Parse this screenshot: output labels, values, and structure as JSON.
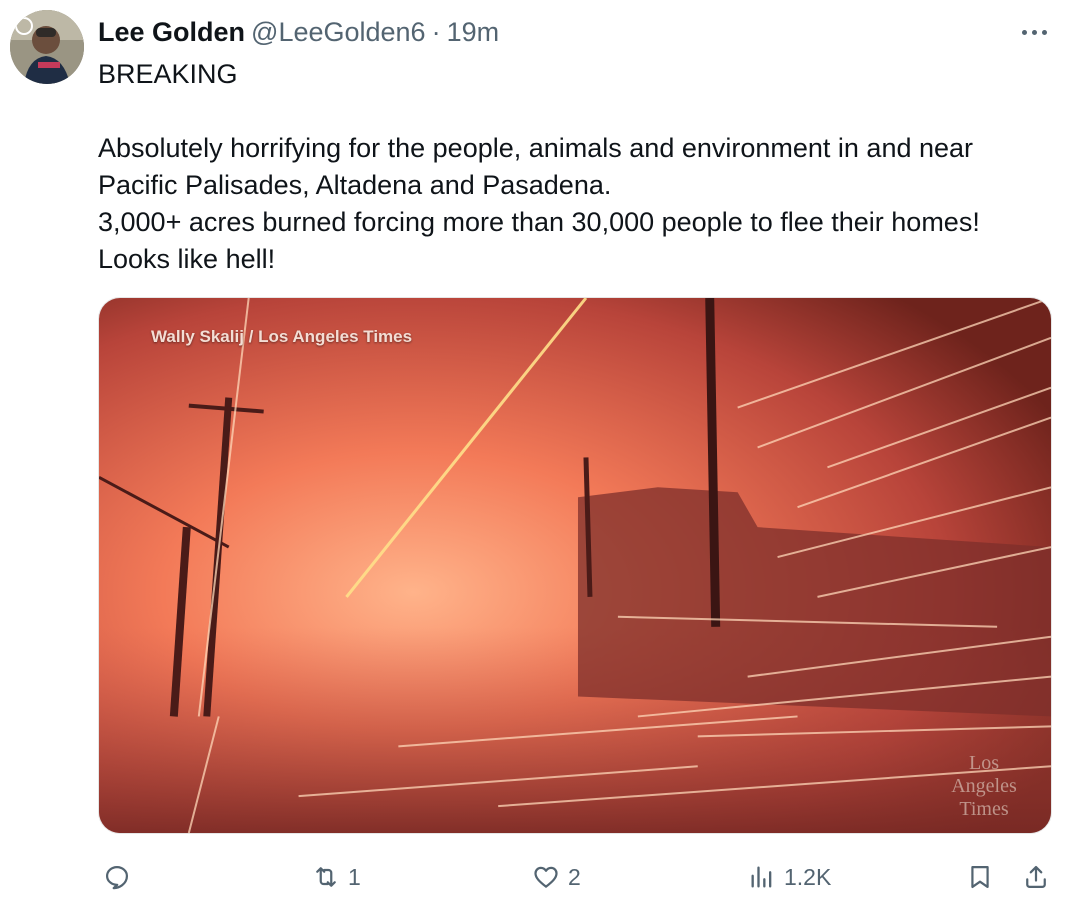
{
  "tweet": {
    "display_name": "Lee Golden",
    "handle": "@LeeGolden6",
    "separator": "·",
    "time": "19m",
    "text_lines": [
      "BREAKING",
      "",
      "Absolutely horrifying for the people, animals and environment in and near",
      "Pacific Palisades, Altadena and Pasadena.",
      "3,000+ acres burned forcing more than 30,000 people to flee their homes!",
      "Looks like hell!"
    ],
    "media": {
      "credit": "Wally Skalij / Los Angeles Times",
      "watermark_lines": [
        "Los",
        "Angeles",
        "Times"
      ]
    }
  },
  "actions": {
    "reply": {
      "icon": "reply-icon",
      "count": ""
    },
    "repost": {
      "icon": "repost-icon",
      "count": "1"
    },
    "like": {
      "icon": "heart-icon",
      "count": "2"
    },
    "views": {
      "icon": "views-icon",
      "count": "1.2K"
    },
    "bookmark": {
      "icon": "bookmark-icon",
      "count": ""
    },
    "share": {
      "icon": "share-icon",
      "count": ""
    }
  },
  "colors": {
    "text_primary": "#0f1419",
    "text_secondary": "#536471",
    "fire_glow": "#ff9a6a",
    "fire_dark": "#6e231c"
  }
}
